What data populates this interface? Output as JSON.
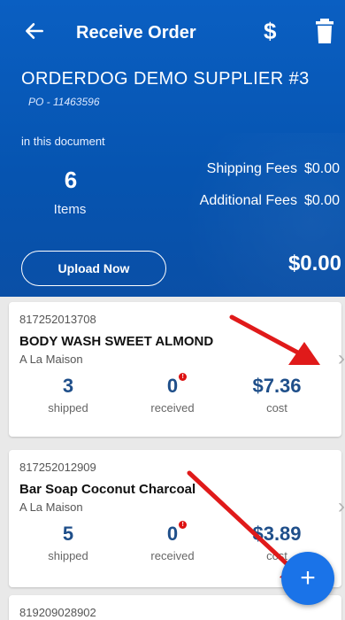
{
  "header": {
    "title": "Receive Order",
    "back_icon": "arrow-left-icon",
    "currency_icon_glyph": "$",
    "delete_icon": "trash-icon",
    "supplier_name": "ORDERDOG DEMO SUPPLIER #3",
    "po_number": "PO - 11463596",
    "in_document_label": "in this document",
    "items_count": "6",
    "items_label": "Items",
    "shipping_fees_label": "Shipping Fees",
    "shipping_fees_value": "$0.00",
    "additional_fees_label": "Additional Fees",
    "additional_fees_value": "$0.00",
    "upload_button_label": "Upload Now",
    "total": "$0.00"
  },
  "cards": [
    {
      "sku": "817252013708",
      "name": "BODY WASH SWEET ALMOND",
      "brand": "A La Maison",
      "shipped": "3",
      "shipped_label": "shipped",
      "received": "0",
      "received_label": "received",
      "received_alert": "!",
      "cost": "$7.36",
      "cost_label": "cost",
      "chevron": "›"
    },
    {
      "sku": "817252012909",
      "name": "Bar Soap Coconut Charcoal",
      "brand": "A La Maison",
      "shipped": "5",
      "shipped_label": "shipped",
      "received": "0",
      "received_label": "received",
      "received_alert": "!",
      "cost": "$3.89",
      "cost_label": "cost",
      "chevron": "›"
    },
    {
      "sku": "819209028902"
    }
  ],
  "fab": {
    "label": "+"
  },
  "colors": {
    "header_blue": "#0654b0",
    "fab_blue": "#1a73e8",
    "stat_blue": "#1f4f8a",
    "alert_red": "#d11111",
    "annotation_red": "#e01a1a"
  }
}
